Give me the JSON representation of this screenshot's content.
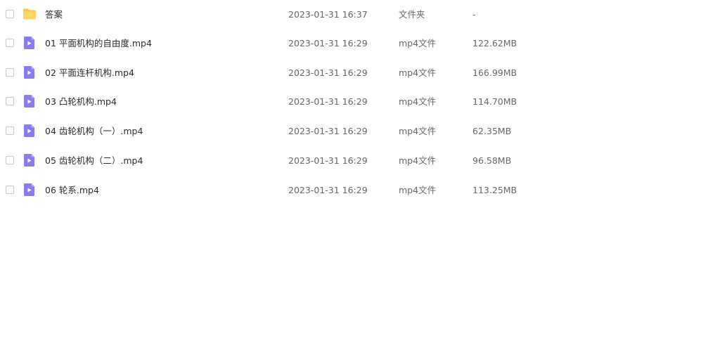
{
  "colors": {
    "folder": "#FFC53D",
    "video": "#8A7CF0",
    "video_play": "#ffffff"
  },
  "rows": [
    {
      "icon": "folder-icon",
      "name": "答案",
      "date": "2023-01-31 16:37",
      "type": "文件夹",
      "size": "-"
    },
    {
      "icon": "video-file-icon",
      "name": "01 平面机构的自由度.mp4",
      "date": "2023-01-31 16:29",
      "type": "mp4文件",
      "size": "122.62MB"
    },
    {
      "icon": "video-file-icon",
      "name": "02 平面连杆机构.mp4",
      "date": "2023-01-31 16:29",
      "type": "mp4文件",
      "size": "166.99MB"
    },
    {
      "icon": "video-file-icon",
      "name": "03 凸轮机构.mp4",
      "date": "2023-01-31 16:29",
      "type": "mp4文件",
      "size": "114.70MB"
    },
    {
      "icon": "video-file-icon",
      "name": "04 齿轮机构（一）.mp4",
      "date": "2023-01-31 16:29",
      "type": "mp4文件",
      "size": "62.35MB"
    },
    {
      "icon": "video-file-icon",
      "name": "05 齿轮机构（二）.mp4",
      "date": "2023-01-31 16:29",
      "type": "mp4文件",
      "size": "96.58MB"
    },
    {
      "icon": "video-file-icon",
      "name": "06 轮系.mp4",
      "date": "2023-01-31 16:29",
      "type": "mp4文件",
      "size": "113.25MB"
    }
  ]
}
